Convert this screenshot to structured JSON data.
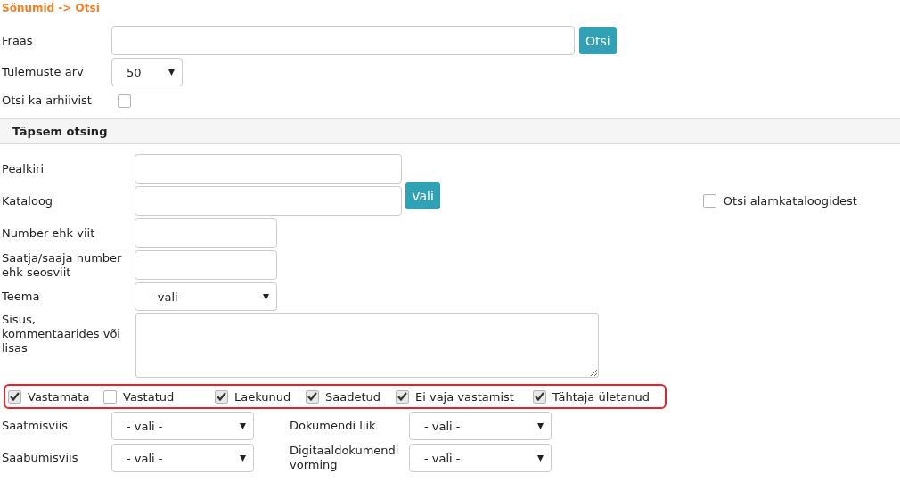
{
  "breadcrumb": "Sõnumid -> Otsi",
  "quick_search": {
    "phrase": {
      "label": "Fraas"
    },
    "search_button": "Otsi",
    "result_count": {
      "label": "Tulemuste arv",
      "value": "50"
    },
    "archive": {
      "label": "Otsi ka arhiivist",
      "checked": false
    }
  },
  "advanced": {
    "title": "Täpsem otsing",
    "fields": [
      {
        "kind": "wide",
        "label": "Pealkiri"
      },
      {
        "kind": "catalog",
        "label": "Kataloog",
        "button": "Vali",
        "option": {
          "label": "Otsi alamkataloogidest",
          "checked": false
        }
      },
      {
        "kind": "short",
        "label": "Number ehk viit"
      },
      {
        "kind": "short",
        "label": "Saatja/saaja number ehk seosviit"
      },
      {
        "kind": "select",
        "label": "Teema",
        "value": "- vali -"
      },
      {
        "kind": "textarea",
        "label": "Sisus, kommentaarides või lisas"
      }
    ],
    "status_filters": [
      {
        "label": "Vastamata",
        "checked": true
      },
      {
        "label": "Vastatud",
        "checked": false
      },
      {
        "label": "Laekunud",
        "checked": true
      },
      {
        "label": "Saadetud",
        "checked": true
      },
      {
        "label": "Ei vaja vastamist",
        "checked": true
      },
      {
        "label": "Tähtaja ületanud",
        "checked": true
      }
    ],
    "select_rows": [
      [
        {
          "label": "Saatmisviis",
          "value": "- vali -"
        },
        {
          "label": "Dokumendi liik",
          "value": "- vali -"
        }
      ],
      [
        {
          "label": "Saabumisviis",
          "value": "- vali -"
        },
        {
          "label": "Digitaaldokumendi vorming",
          "value": "- vali -"
        }
      ]
    ]
  }
}
